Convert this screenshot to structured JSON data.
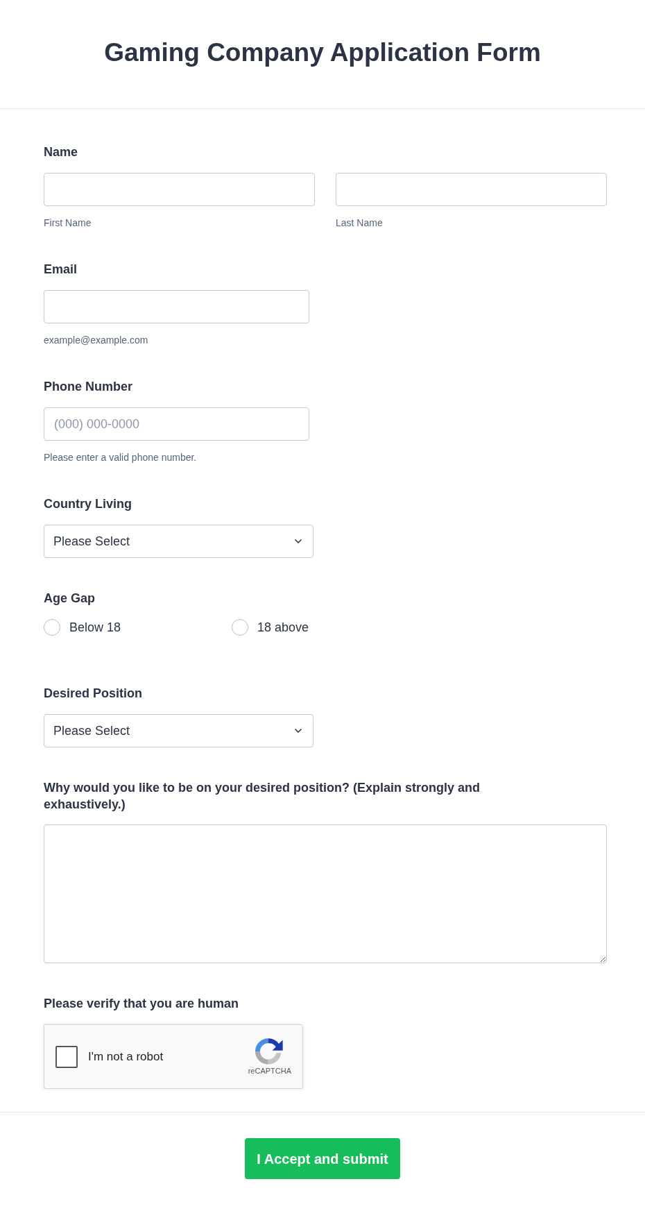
{
  "title": "Gaming Company Application Form",
  "fields": [
    {
      "kind": "name",
      "label": "Name",
      "parts": [
        {
          "sublabel": "First Name"
        },
        {
          "sublabel": "Last Name"
        }
      ]
    },
    {
      "kind": "text",
      "label": "Email",
      "sublabel": "example@example.com"
    },
    {
      "kind": "text",
      "label": "Phone Number",
      "placeholder": "(000) 000-0000",
      "sublabel": "Please enter a valid phone number."
    },
    {
      "kind": "select",
      "label": "Country Living",
      "value": "Please Select"
    },
    {
      "kind": "radio",
      "label": "Age Gap",
      "options": [
        {
          "label": "Below 18",
          "selected": false
        },
        {
          "label": "18 above",
          "selected": false
        }
      ]
    },
    {
      "kind": "select",
      "label": "Desired Position",
      "value": "Please Select"
    },
    {
      "kind": "textarea",
      "label": "Why would you like to be on your desired position? (Explain strongly and exhaustively.)"
    },
    {
      "kind": "captcha",
      "label": "Please verify that you are human",
      "checkbox_label": "I'm not a robot",
      "checked": false,
      "badge": "reCAPTCHA"
    }
  ],
  "submit": {
    "label": "I Accept and submit"
  }
}
